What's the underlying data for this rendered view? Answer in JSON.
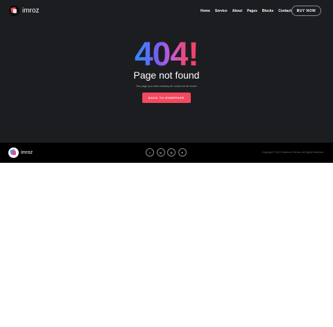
{
  "brand": {
    "name": "imroz"
  },
  "nav": [
    "Home",
    "Service",
    "About",
    "Pages",
    "Blocks",
    "Contact"
  ],
  "header": {
    "buy_label": "BUY NOW"
  },
  "error": {
    "code_digits": "404",
    "code_bang": "!",
    "title": "Page not found",
    "subtitle": "The page you were looking for could not be found.",
    "button_label": "BACK TO HOMEPAGE"
  },
  "footer": {
    "brand": "imroz",
    "socials": [
      {
        "icon": "facebook-icon",
        "glyph": "f"
      },
      {
        "icon": "linkedin-icon",
        "glyph": "in"
      },
      {
        "icon": "instagram-icon",
        "glyph": "◎"
      },
      {
        "icon": "twitter-icon",
        "glyph": "✦"
      }
    ],
    "copyright": "Copyright © 2021 Rainbow-Themes. All Rights Reserved."
  },
  "colors": {
    "accent": "#f4495f",
    "hero_bg": "#1c1d20",
    "footer_bg": "#000000"
  }
}
